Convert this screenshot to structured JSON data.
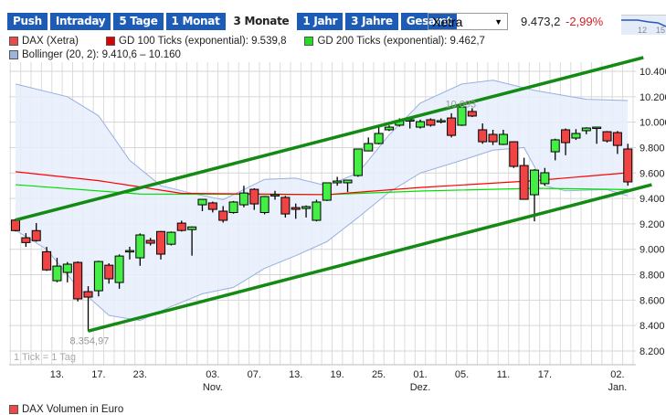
{
  "tabs": [
    {
      "label": "Push"
    },
    {
      "label": "Intraday"
    },
    {
      "label": "5 Tage"
    },
    {
      "label": "1 Monat"
    },
    {
      "label": "3 Monate",
      "active": true
    },
    {
      "label": "1 Jahr"
    },
    {
      "label": "3 Jahre"
    },
    {
      "label": "Gesamt"
    }
  ],
  "exchange_select": {
    "value": "Xetra"
  },
  "quote": {
    "price": "9.473,2",
    "change": "-2,99%"
  },
  "mini_chart": {
    "labels": [
      "12",
      "15"
    ]
  },
  "legend": [
    {
      "label": "DAX (Xetra)",
      "color": "#f04848"
    },
    {
      "label": "GD 100 Ticks (exponential): 9.539,8",
      "color": "#e00000"
    },
    {
      "label": "GD 200 Ticks (exponential): 9.462,7",
      "color": "#22dd22"
    },
    {
      "label": "Bollinger (20, 2): 9.410,6 – 10.160",
      "color": "#9fb4dc"
    }
  ],
  "colors": {
    "up": "#44ee44",
    "down": "#f04444",
    "trend": "#138a13",
    "gd100": "#ff0000",
    "gd200": "#00e000",
    "band": "#e6effb",
    "band_line": "#98b0e0",
    "tab": "#1c5bb6"
  },
  "chart_data": {
    "type": "candlestick",
    "ylim": [
      8200,
      10400
    ],
    "yticks": [
      "8.200",
      "8.400",
      "8.600",
      "8.800",
      "9.000",
      "9.200",
      "9.400",
      "9.600",
      "9.800",
      "10.000",
      "10.200",
      "10.400"
    ],
    "ytick_values": [
      8200,
      8400,
      8600,
      8800,
      9000,
      9200,
      9400,
      9600,
      9800,
      10000,
      10200,
      10400
    ],
    "xticks": [
      {
        "date": "13.10.",
        "label": "13."
      },
      {
        "date": "17.10.",
        "label": "17."
      },
      {
        "date": "23.10.",
        "label": "23."
      },
      {
        "date": "03.11.",
        "label": "03.",
        "sub": "Nov."
      },
      {
        "date": "07.11.",
        "label": "07."
      },
      {
        "date": "13.11.",
        "label": "13."
      },
      {
        "date": "19.11.",
        "label": "19."
      },
      {
        "date": "25.11.",
        "label": "25."
      },
      {
        "date": "01.12.",
        "label": "01.",
        "sub": "Dez."
      },
      {
        "date": "05.12.",
        "label": "05."
      },
      {
        "date": "11.12.",
        "label": "11."
      },
      {
        "date": "17.12.",
        "label": "17."
      },
      {
        "date": "02.01.",
        "label": "02.",
        "sub": "Jan."
      }
    ],
    "note": "1 Tick = 1 Tag",
    "annotations": [
      {
        "date": "05.12.",
        "value": 10093,
        "label": "10.093"
      },
      {
        "date": "16.10.",
        "value": 8354.97,
        "label": "8.354,97"
      }
    ],
    "candles": [
      [
        "07.10.",
        9230,
        9240,
        9140,
        9147
      ],
      [
        "08.10.",
        9091,
        9127,
        9019,
        9053
      ],
      [
        "09.10.",
        9147,
        9206,
        9060,
        9068
      ],
      [
        "10.10.",
        8981,
        9019,
        8830,
        8838
      ],
      [
        "13.10.",
        8753,
        8933,
        8740,
        8868
      ],
      [
        "14.10.",
        8818,
        8900,
        8740,
        8883
      ],
      [
        "15.10.",
        8897,
        8905,
        8590,
        8610
      ],
      [
        "16.10.",
        8667,
        8710,
        8355,
        8624
      ],
      [
        "17.10.",
        8674,
        8910,
        8630,
        8904
      ],
      [
        "20.10.",
        8875,
        8890,
        8730,
        8768
      ],
      [
        "21.10.",
        8739,
        8960,
        8690,
        8947
      ],
      [
        "22.10.",
        8990,
        9020,
        8920,
        8990
      ],
      [
        "23.10.",
        8933,
        9125,
        8870,
        9113
      ],
      [
        "24.10.",
        9070,
        9090,
        9030,
        9048
      ],
      [
        "27.10.",
        9140,
        9145,
        8920,
        8962
      ],
      [
        "28.10.",
        9040,
        9140,
        9030,
        9134
      ],
      [
        "29.10.",
        9206,
        9225,
        9140,
        9148
      ],
      [
        "30.10.",
        9155,
        9180,
        8950,
        9176
      ],
      [
        "31.10.",
        9350,
        9395,
        9300,
        9393
      ],
      [
        "03.11.",
        9365,
        9375,
        9290,
        9314
      ],
      [
        "04.11.",
        9300,
        9340,
        9210,
        9228
      ],
      [
        "05.11.",
        9289,
        9380,
        9280,
        9372
      ],
      [
        "06.11.",
        9350,
        9500,
        9330,
        9443
      ],
      [
        "07.11.",
        9472,
        9480,
        9310,
        9357
      ],
      [
        "10.11.",
        9289,
        9420,
        9275,
        9415
      ],
      [
        "11.11.",
        9430,
        9460,
        9390,
        9430
      ],
      [
        "12.11.",
        9408,
        9420,
        9250,
        9278
      ],
      [
        "13.11.",
        9328,
        9360,
        9240,
        9314
      ],
      [
        "14.11.",
        9321,
        9345,
        9250,
        9336
      ],
      [
        "17.11.",
        9228,
        9390,
        9220,
        9372
      ],
      [
        "18.11.",
        9386,
        9523,
        9380,
        9523
      ],
      [
        "19.11.",
        9523,
        9570,
        9500,
        9537
      ],
      [
        "20.11.",
        9523,
        9545,
        9450,
        9544
      ],
      [
        "21.11.",
        9580,
        9790,
        9570,
        9789
      ],
      [
        "24.11.",
        9774,
        9880,
        9770,
        9832
      ],
      [
        "25.11.",
        9832,
        9960,
        9825,
        9911
      ],
      [
        "26.11.",
        9940,
        9975,
        9930,
        9961
      ],
      [
        "27.11.",
        9976,
        10030,
        9965,
        10012
      ],
      [
        "28.11.",
        10019,
        10030,
        9950,
        10019
      ],
      [
        "01.12.",
        9961,
        10020,
        9950,
        10004
      ],
      [
        "02.12.",
        10019,
        10030,
        9965,
        9976
      ],
      [
        "03.12.",
        10012,
        10030,
        9990,
        10012
      ],
      [
        "04.12.",
        10033,
        10070,
        9880,
        9896
      ],
      [
        "05.12.",
        9976,
        10093,
        9970,
        10119
      ],
      [
        "08.12.",
        10084,
        10110,
        10040,
        10048
      ],
      [
        "09.12.",
        9940,
        9990,
        9830,
        9846
      ],
      [
        "10.12.",
        9904,
        9940,
        9820,
        9846
      ],
      [
        "11.12.",
        9825,
        9940,
        9820,
        9904
      ],
      [
        "12.12.",
        9846,
        9850,
        9640,
        9652
      ],
      [
        "15.12.",
        9659,
        9720,
        9390,
        9393
      ],
      [
        "16.12.",
        9429,
        9630,
        9220,
        9623
      ],
      [
        "17.12.",
        9516,
        9640,
        9500,
        9602
      ],
      [
        "18.12.",
        9767,
        9870,
        9700,
        9861
      ],
      [
        "19.12.",
        9940,
        9950,
        9740,
        9839
      ],
      [
        "22.12.",
        9875,
        9945,
        9860,
        9911
      ],
      [
        "23.12.",
        9933,
        9960,
        9905,
        9954
      ],
      [
        "29.12.",
        9961,
        9962,
        9830,
        9961
      ],
      [
        "30.12.",
        9925,
        9930,
        9840,
        9853
      ],
      [
        "02.01.",
        9918,
        9930,
        9750,
        9817
      ],
      [
        "05.01.",
        9789,
        9830,
        9500,
        9530
      ]
    ],
    "bollinger_upper": [
      [
        0,
        10300
      ],
      [
        5,
        10200
      ],
      [
        8,
        10050
      ],
      [
        11,
        9700
      ],
      [
        14,
        9500
      ],
      [
        17,
        9440
      ],
      [
        20,
        9390
      ],
      [
        24,
        9550
      ],
      [
        27,
        9560
      ],
      [
        30,
        9500
      ],
      [
        33,
        9600
      ],
      [
        36,
        9900
      ],
      [
        39,
        10150
      ],
      [
        43,
        10300
      ],
      [
        46,
        10330
      ],
      [
        50,
        10250
      ],
      [
        55,
        10180
      ],
      [
        59,
        10170
      ]
    ],
    "bollinger_lower": [
      [
        0,
        9150
      ],
      [
        3,
        9000
      ],
      [
        6,
        8700
      ],
      [
        9,
        8480
      ],
      [
        12,
        8440
      ],
      [
        15,
        8550
      ],
      [
        18,
        8650
      ],
      [
        21,
        8700
      ],
      [
        24,
        8850
      ],
      [
        27,
        8950
      ],
      [
        30,
        9060
      ],
      [
        33,
        9250
      ],
      [
        36,
        9450
      ],
      [
        39,
        9600
      ],
      [
        43,
        9700
      ],
      [
        46,
        9780
      ],
      [
        49,
        9800
      ],
      [
        51,
        9500
      ],
      [
        53,
        9460
      ],
      [
        57,
        9470
      ],
      [
        59,
        9420
      ]
    ],
    "gd100": [
      [
        0,
        9610
      ],
      [
        8,
        9540
      ],
      [
        16,
        9440
      ],
      [
        30,
        9430
      ],
      [
        39,
        9486
      ],
      [
        50,
        9540
      ],
      [
        59,
        9602
      ]
    ],
    "gd200": [
      [
        0,
        9508
      ],
      [
        12,
        9435
      ],
      [
        30,
        9430
      ],
      [
        39,
        9458
      ],
      [
        50,
        9480
      ],
      [
        59,
        9470
      ]
    ],
    "trendlines": [
      {
        "from": [
          0,
          9230
        ],
        "to": [
          60.5,
          10508
        ]
      },
      {
        "from": [
          7,
          8357
        ],
        "to": [
          61.3,
          9508
        ]
      }
    ]
  },
  "volume_legend": {
    "label": "DAX Volumen in Euro"
  }
}
